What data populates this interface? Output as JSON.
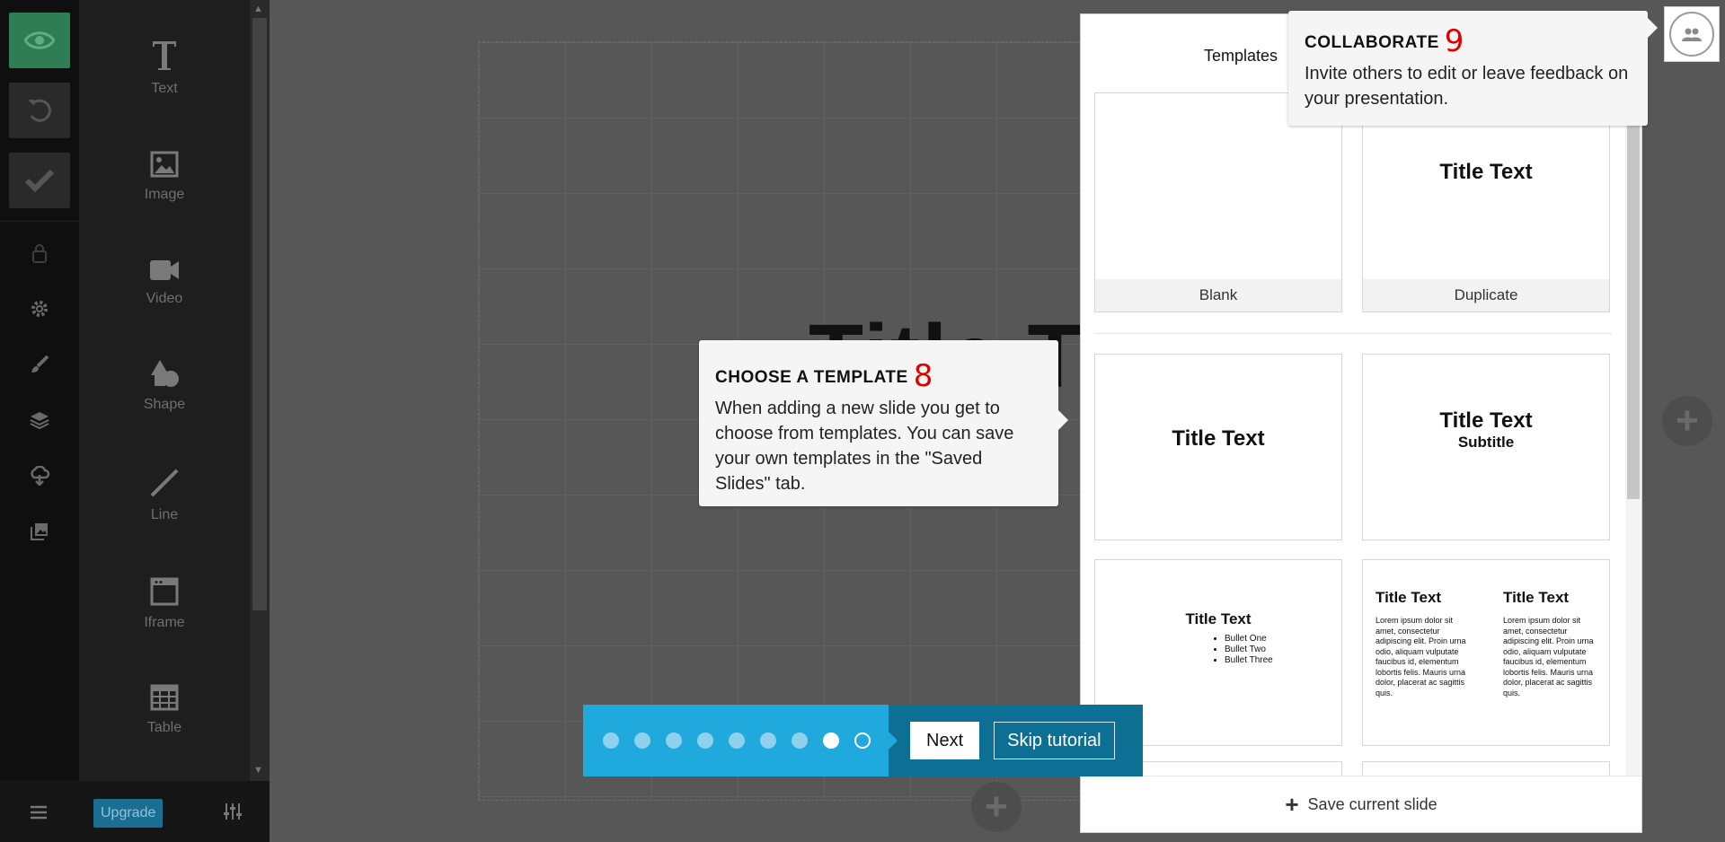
{
  "tools": [
    {
      "label": "Text",
      "icon": "text-icon"
    },
    {
      "label": "Image",
      "icon": "image-icon"
    },
    {
      "label": "Video",
      "icon": "video-icon"
    },
    {
      "label": "Shape",
      "icon": "shape-icon"
    },
    {
      "label": "Line",
      "icon": "line-icon"
    },
    {
      "label": "Iframe",
      "icon": "iframe-icon"
    },
    {
      "label": "Table",
      "icon": "table-icon"
    }
  ],
  "footer": {
    "upgrade_label": "Upgrade"
  },
  "slide": {
    "title_text": "Title Te"
  },
  "templates": {
    "tab_label": "Templates",
    "cards": {
      "blank": "Blank",
      "duplicate": "Duplicate",
      "duplicate_title": "Title Text",
      "title_only": "Title Text",
      "title_sub_title": "Title Text",
      "title_sub_subtitle": "Subtitle",
      "bullets_title": "Title Text",
      "bullets": [
        "Bullet One",
        "Bullet Two",
        "Bullet Three"
      ],
      "two_col_title_left": "Title Text",
      "two_col_title_right": "Title Text",
      "two_col_body_left": "Lorem ipsum dolor sit amet, consectetur adipiscing elit. Proin urna odio, aliquam vulputate faucibus id, elementum lobortis felis. Mauris urna dolor, placerat ac sagittis quis.",
      "two_col_body_right": "Lorem ipsum dolor sit amet, consectetur adipiscing elit. Proin urna odio, aliquam vulputate faucibus id, elementum lobortis felis. Mauris urna dolor, placerat ac sagittis quis."
    },
    "save_label": "Save current slide"
  },
  "tips": {
    "collaborate": {
      "title": "COLLABORATE",
      "step": "9",
      "body": "Invite others to edit or leave feedback on your presentation."
    },
    "template": {
      "title": "CHOOSE A TEMPLATE",
      "step": "8",
      "body": "When adding a new slide you get to choose from templates. You can save your own templates in the \"Saved Slides\" tab."
    }
  },
  "tutorial": {
    "next_label": "Next",
    "skip_label": "Skip tutorial",
    "total_steps": 9,
    "current_step": 8
  },
  "colors": {
    "preview_green": "#2f7d52",
    "tutorial_blue": "#1fa9dc",
    "tutorial_dark": "#0e6f94",
    "step_number": "#e00000"
  }
}
